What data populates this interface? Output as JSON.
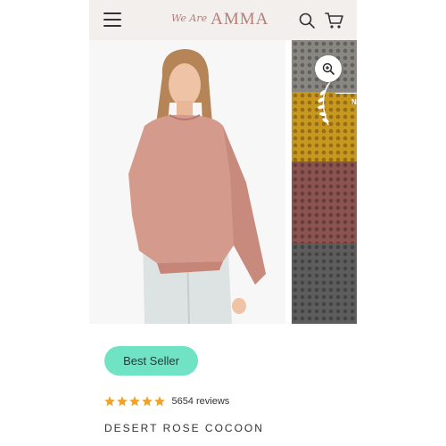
{
  "header": {
    "logo_script": "We Are",
    "logo_main": "AMMA"
  },
  "icons": {
    "menu": "hamburger-menu-icon",
    "search": "search-icon",
    "cart": "cart-icon",
    "zoom": "zoom-in-icon",
    "badge": "laurel-icon"
  },
  "gallery": {
    "badge_text": "N",
    "swatch_colors": [
      "#898781",
      "#c7971e",
      "#8b5450",
      "#5d5d5d"
    ],
    "main_photo_colors": {
      "poncho": "#d49a8c",
      "jeans": "#dde3e3",
      "hair": "#b58457"
    }
  },
  "product": {
    "badge_label": "Best Seller",
    "rating": 5,
    "rating_max": 5,
    "reviews_text": "5654 reviews",
    "title": "DESERT ROSE COCOON"
  },
  "colors": {
    "header_bg": "#f3efec",
    "logo": "#b27f77",
    "badge_bg": "#6fe3c4",
    "star": "#f0a22b"
  }
}
